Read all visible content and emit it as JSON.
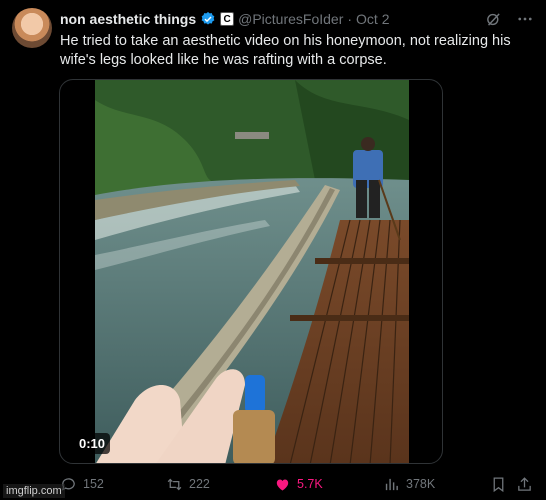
{
  "tweet": {
    "display_name": "non aesthetic things",
    "affiliate_badge": "C",
    "handle": "@PicturesFoIder",
    "separator": "·",
    "date": "Oct 2",
    "text": "He tried to take an aesthetic video on his honeymoon, not realizing his wife's legs looked like he was rafting with a corpse.",
    "video_duration": "0:10"
  },
  "actions": {
    "replies": "152",
    "reposts": "222",
    "likes": "5.7K",
    "views": "378K"
  },
  "icons": {
    "verified": "verified-badge-icon",
    "grok": "grok-icon",
    "more": "more-icon",
    "reply": "reply-icon",
    "repost": "repost-icon",
    "like": "heart-icon",
    "views": "views-icon",
    "bookmark": "bookmark-icon",
    "share": "share-icon"
  },
  "colors": {
    "background": "#000000",
    "text": "#e7e9ea",
    "muted": "#71767b",
    "verified": "#1d9bf0",
    "like": "#f91880"
  },
  "watermark": "imgflip.com"
}
